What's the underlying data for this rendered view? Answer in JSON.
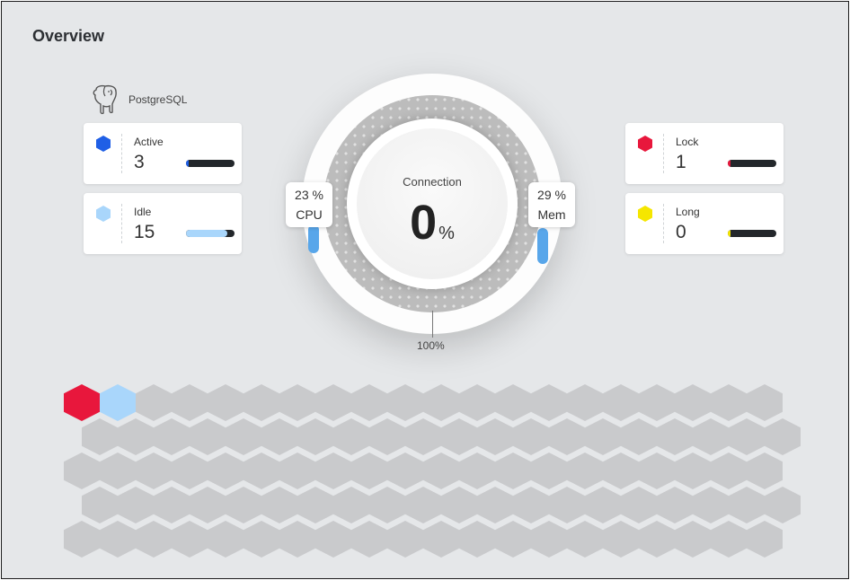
{
  "header": {
    "title": "Overview"
  },
  "database": {
    "name": "PostgreSQL",
    "icon": "elephant-icon"
  },
  "stats": [
    {
      "label": "Active",
      "value": "3",
      "color": "#1f5fe6",
      "bar_color": "#1f5fe6",
      "fraction": 0.05
    },
    {
      "label": "Idle",
      "value": "15",
      "color": "#a9d6fb",
      "bar_color": "#a9d6fb",
      "fraction": 0.85
    },
    {
      "label": "Lock",
      "value": "1",
      "color": "#e8173c",
      "bar_color": "#e8173c",
      "fraction": 0.05
    },
    {
      "label": "Long",
      "value": "0",
      "color": "#f5e600",
      "bar_color": "#f5e600",
      "fraction": 0.05
    }
  ],
  "gauge": {
    "label": "Connection",
    "value": "0",
    "unit": "%",
    "max_label": "100%",
    "cpu": {
      "value": "23 %",
      "label": "CPU",
      "fraction": 0.23
    },
    "mem": {
      "value": "29 %",
      "label": "Mem",
      "fraction": 0.29
    },
    "arc_color": "#58a6ea"
  },
  "honeycomb": {
    "colors": {
      "active": "#e8173c",
      "idle": "#a9d6fb",
      "empty": "#c9cacc"
    },
    "cells": [
      "lock",
      "idle"
    ]
  }
}
